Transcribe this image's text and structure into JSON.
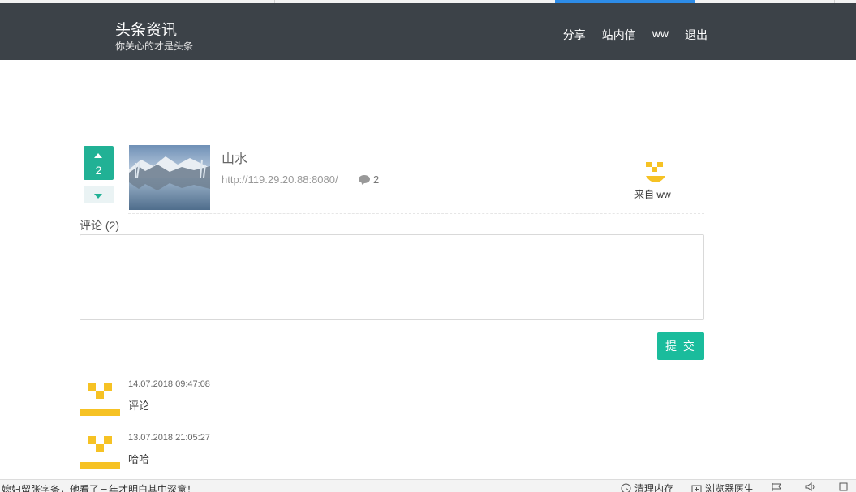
{
  "header": {
    "title": "头条资讯",
    "subtitle": "你关心的才是头条",
    "nav": [
      "分享",
      "站内信",
      "ww",
      "退出"
    ]
  },
  "news": {
    "vote_count": "2",
    "title": "山水",
    "link": "http://119.29.20.88:8080/",
    "comment_count": "2",
    "author_label": "来自 ww"
  },
  "comments_section": {
    "heading": "评论 (2)",
    "textarea_value": "",
    "submit_label": "提 交",
    "items": [
      {
        "time": "14.07.2018 09:47:08",
        "text": "评论"
      },
      {
        "time": "13.07.2018 21:05:27",
        "text": "哈哈"
      }
    ]
  },
  "statusbar": {
    "news_text": "媳妇留张字条，他看了三年才明白其中深意！",
    "clean_memory": "清理内存",
    "browser_doctor": "浏览器医生"
  },
  "colors": {
    "header_bg": "#3c4248",
    "accent": "#21b195",
    "submit": "#1abc9c",
    "avatar": "#f6c224"
  }
}
